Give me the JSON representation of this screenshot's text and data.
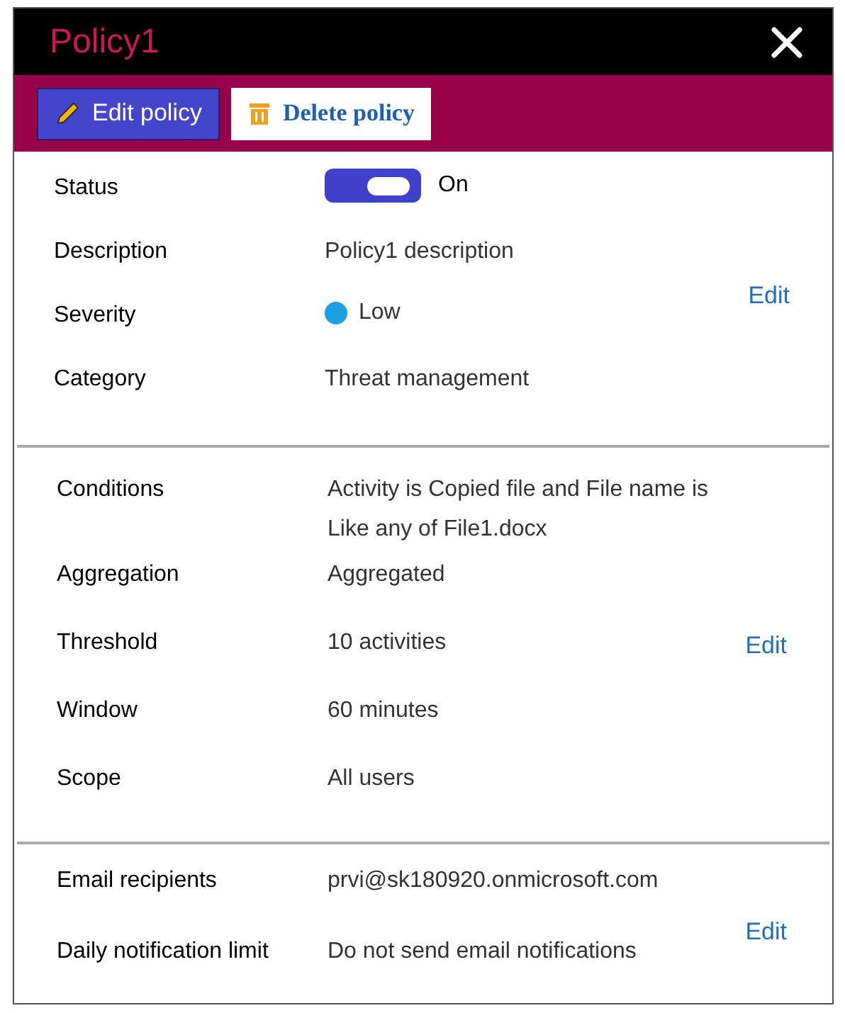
{
  "window": {
    "title": "Policy1"
  },
  "toolbar": [
    {
      "kind": "edit",
      "label": "Edit policy"
    },
    {
      "kind": "delete",
      "label": "Delete policy"
    }
  ],
  "sections": [
    {
      "edit_link": "Edit",
      "fields": [
        {
          "kind": "toggle",
          "label": "Status",
          "on": true,
          "value": "On"
        },
        {
          "kind": "text",
          "label": "Description",
          "value": "Policy1 description"
        },
        {
          "kind": "dot",
          "label": "Severity",
          "color": "#1ba1e2",
          "value": "Low"
        },
        {
          "kind": "text",
          "label": "Category",
          "value": "Threat management"
        }
      ]
    },
    {
      "edit_link": "Edit",
      "fields": [
        {
          "kind": "text",
          "label": "Conditions",
          "value": "Activity is Copied file and File name is Like any of File1.docx"
        },
        {
          "kind": "text",
          "label": "Aggregation",
          "value": "Aggregated"
        },
        {
          "kind": "text",
          "label": "Threshold",
          "value": "10 activities"
        },
        {
          "kind": "text",
          "label": "Window",
          "value": "60 minutes"
        },
        {
          "kind": "text",
          "label": "Scope",
          "value": "All users"
        }
      ]
    },
    {
      "edit_link": "Edit",
      "fields": [
        {
          "kind": "text",
          "label": "Email recipients",
          "value": "prvi@sk180920.onmicrosoft.com"
        },
        {
          "kind": "text",
          "label": "Daily notification limit",
          "value": "Do not send email notifications"
        }
      ]
    }
  ]
}
